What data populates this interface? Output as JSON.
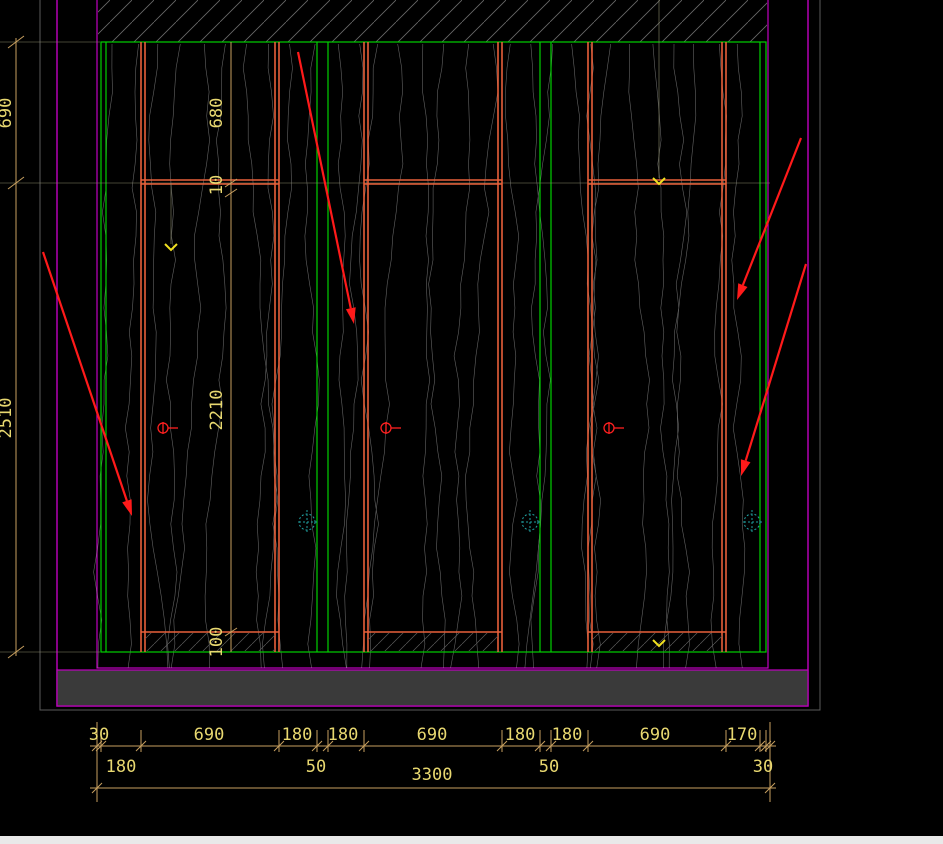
{
  "colors": {
    "background": "#000000",
    "frame": "#c000c0",
    "panel_outline": "#00d000",
    "door_frame": "#e8603a",
    "grain": "#b8b8b8",
    "dimension": "#c8a060",
    "dimension_text": "#e8d870",
    "arrow": "#ff1a1a",
    "handle": "#ff2020",
    "hinge": "#20a0a0",
    "floor": "#3a3a3a"
  },
  "vertical_dims": {
    "top": "690",
    "main": "2510",
    "inner_top": "680",
    "inner_gap": "10",
    "inner_main": "2210",
    "inner_bottom": "100"
  },
  "horizontal_dims": {
    "row1": [
      "30",
      "690",
      "180",
      "180",
      "690",
      "180",
      "180",
      "690",
      "170"
    ],
    "row2": [
      "180",
      "50",
      "50",
      "30"
    ],
    "total": "3300"
  },
  "icons": {
    "arrow": "red-arrow-icon",
    "handle": "handle-symbol-icon",
    "hinge": "hinge-symbol-icon",
    "open_marker": "open-direction-chevron-icon"
  }
}
